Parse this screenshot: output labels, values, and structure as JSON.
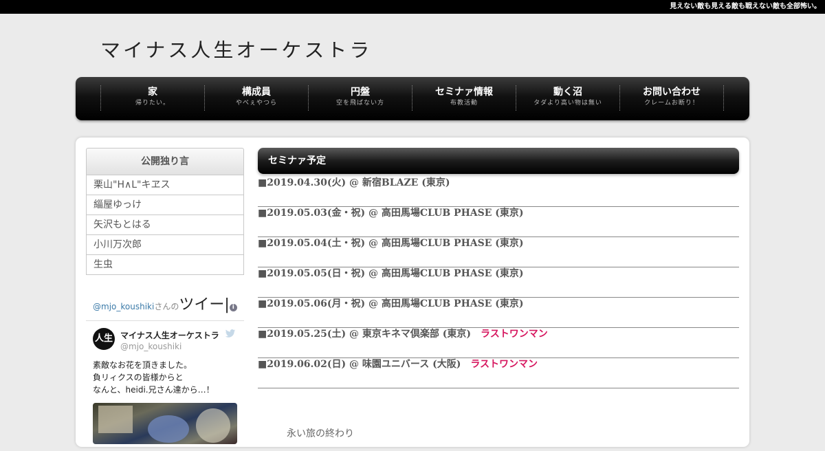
{
  "topbar": {
    "text": "見えない敵も見える敵も戦えない敵も全部怖い。"
  },
  "logo": {
    "text": "マイナス人生オーケストラ"
  },
  "nav": [
    {
      "title": "家",
      "sub": "帰りたい。"
    },
    {
      "title": "構成員",
      "sub": "やべぇやつら"
    },
    {
      "title": "円盤",
      "sub": "空を飛ばない方"
    },
    {
      "title": "セミナァ情報",
      "sub": "布教活動"
    },
    {
      "title": "動く沼",
      "sub": "タダより高い物は無い"
    },
    {
      "title": "お問い合わせ",
      "sub": "クレームお断り！"
    }
  ],
  "sidebar": {
    "heading": "公開独り言",
    "items": [
      "栗山\"H∧L\"キヱス",
      "緇屋ゆっけ",
      "矢沢もとはる",
      "小川万次郎",
      "生虫"
    ]
  },
  "twitter": {
    "handle": "@mjo_koushiki",
    "handle_suffix": "さんの",
    "title": "ツイー",
    "info_icon": "i",
    "tweet": {
      "avatar_text": "人生",
      "name": "マイナス人生オーケストラ",
      "user": "@mjo_koushiki",
      "lines": [
        "素敵なお花を頂きました。",
        "負リィクスの皆様からと",
        "なんと、heidi.兄さん達から…！"
      ]
    }
  },
  "main": {
    "heading": "セミナァ予定",
    "schedule": [
      {
        "text": "■2019.04.30(火) @ 新宿BLAZE (東京)",
        "tag": ""
      },
      {
        "text": "■2019.05.03(金・祝) @ 高田馬場CLUB PHASE (東京)",
        "tag": ""
      },
      {
        "text": "■2019.05.04(土・祝) @ 高田馬場CLUB PHASE (東京)",
        "tag": ""
      },
      {
        "text": "■2019.05.05(日・祝) @ 高田馬場CLUB PHASE (東京)",
        "tag": ""
      },
      {
        "text": "■2019.05.06(月・祝) @ 高田馬場CLUB PHASE (東京)",
        "tag": ""
      },
      {
        "text": "■2019.05.25(土) @ 東京キネマ倶楽部 (東京)",
        "tag": "ラストワンマン"
      },
      {
        "text": "■2019.06.02(日) @ 味園ユニバース (大阪)",
        "tag": "ラストワンマン"
      }
    ],
    "bottom_text": "永い旅の終わり"
  },
  "colors": {
    "accent": "#d6175f",
    "nav_bg": "#111111",
    "page_bg": "#ebebeb"
  }
}
